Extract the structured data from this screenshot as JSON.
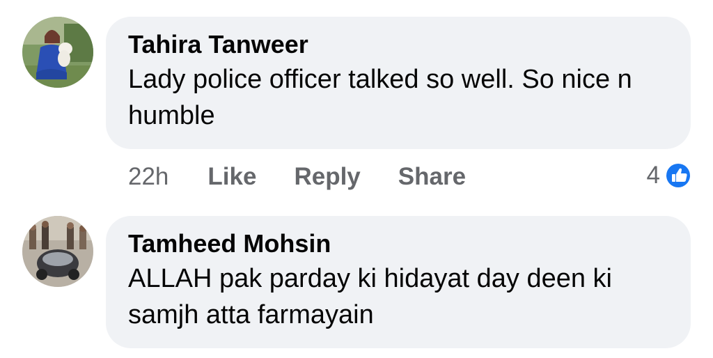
{
  "comments": [
    {
      "author": "Tahira Tanweer",
      "text": "Lady police officer talked so well. So nice n humble",
      "time": "22h",
      "like_label": "Like",
      "reply_label": "Reply",
      "share_label": "Share",
      "reaction_count": "4",
      "reaction_icon": "like-reaction-icon",
      "reaction_color": "#1877f2"
    },
    {
      "author": "Tamheed Mohsin",
      "text": "ALLAH pak parday ki hidayat day deen ki samjh atta farmayain"
    }
  ],
  "colors": {
    "bubble": "#f0f2f5",
    "secondary_text": "#65676b",
    "accent": "#1877f2"
  }
}
